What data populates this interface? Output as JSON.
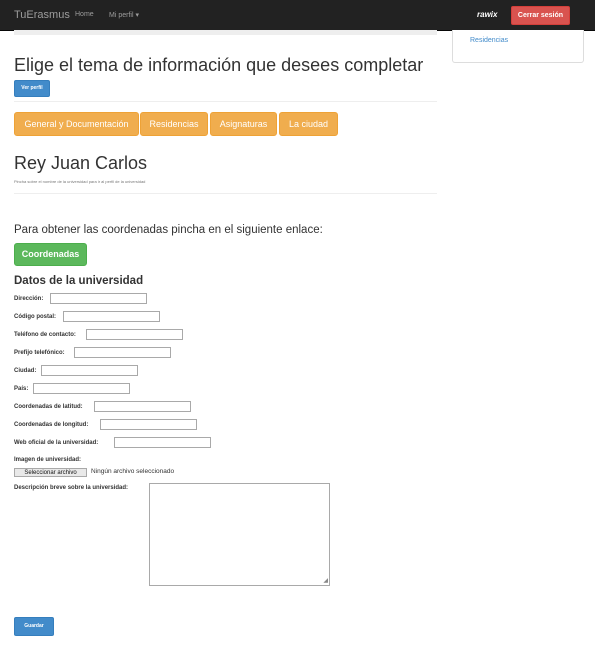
{
  "navbar": {
    "brand": "TuErasmus",
    "home": "Home",
    "profile_menu": "Mi perfil ▾",
    "logo_text": "rawix",
    "logout": "Cerrar sesión"
  },
  "side_panel": {
    "link": "Residencias"
  },
  "main": {
    "title": "Elige el tema de información que desees completar",
    "view_profile": "Ver perfil",
    "tabs": [
      "General y Documentación",
      "Residencias",
      "Asignaturas",
      "La ciudad"
    ],
    "university": "Rey Juan Carlos",
    "university_hint": "Pincha sobre el nombre de la universidad para ir al perfil de la universidad",
    "coords_text": "Para obtener las coordenadas pincha en el siguiente enlace:",
    "coords_button": "Coordenadas"
  },
  "form": {
    "heading": "Datos de la universidad",
    "fields": [
      {
        "label": "Dirección:",
        "value": ""
      },
      {
        "label": "Código postal:",
        "value": ""
      },
      {
        "label": "Teléfono de contacto:",
        "value": ""
      },
      {
        "label": "Prefijo telefónico:",
        "value": ""
      },
      {
        "label": "Ciudad:",
        "value": ""
      },
      {
        "label": "País:",
        "value": ""
      },
      {
        "label": "Coordenadas de latitud:",
        "value": ""
      },
      {
        "label": "Coordenadas de longitud:",
        "value": ""
      },
      {
        "label": "Web oficial de la universidad:",
        "value": ""
      }
    ],
    "image_label": "Imagen de universidad:",
    "file_button": "Seleccionar archivo",
    "file_status": "Ningún archivo seleccionado",
    "description_label": "Descripción breve sobre la universidad:",
    "description_value": "",
    "save": "Guardar"
  }
}
